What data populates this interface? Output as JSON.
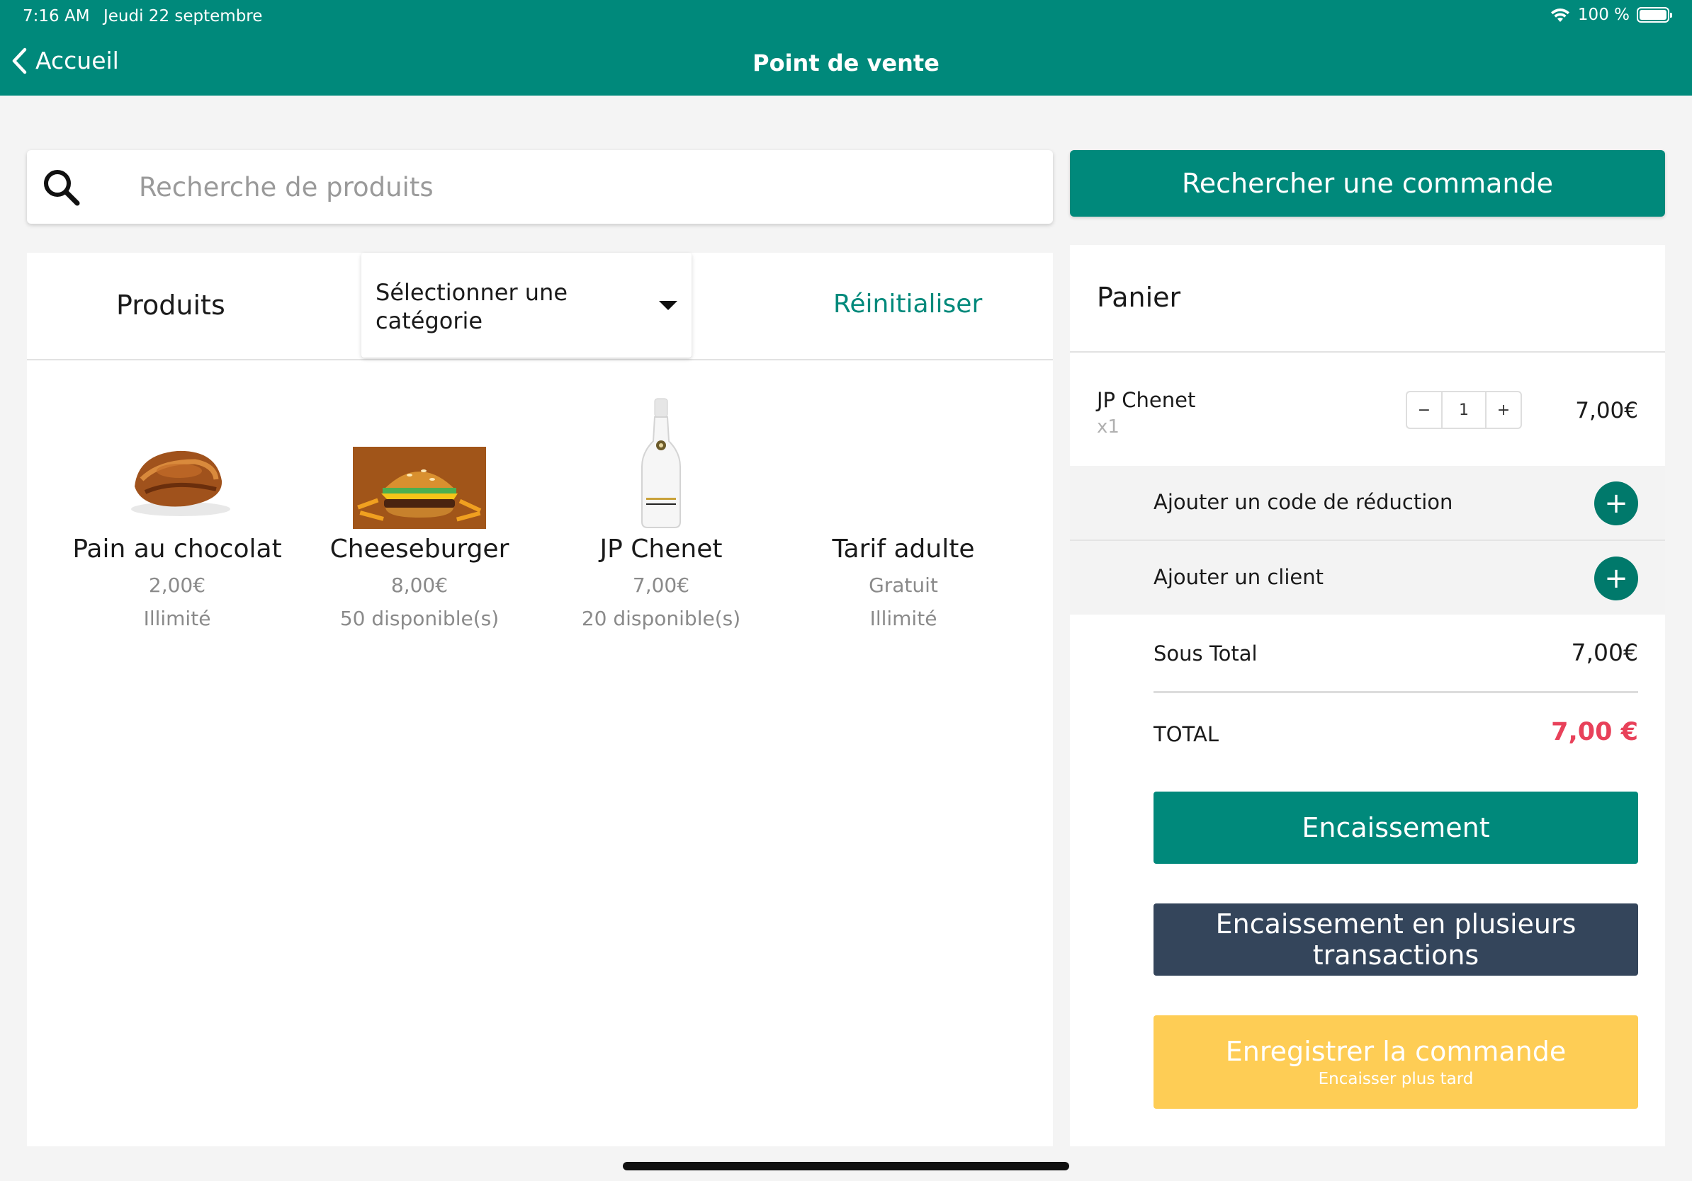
{
  "status_bar": {
    "time": "7:16 AM",
    "date": "Jeudi 22 septembre",
    "battery": "100 %"
  },
  "nav": {
    "back_label": "Accueil",
    "title": "Point de vente"
  },
  "search": {
    "placeholder": "Recherche de produits"
  },
  "find_order_label": "Rechercher une commande",
  "products_panel": {
    "title": "Produits",
    "category_select": "Sélectionner une catégorie",
    "reset_label": "Réinitialiser",
    "items": [
      {
        "name": "Pain au chocolat",
        "price": "2,00€",
        "stock": "Illimité",
        "image": "pain-au-chocolat"
      },
      {
        "name": "Cheeseburger",
        "price": "8,00€",
        "stock": "50 disponible(s)",
        "image": "cheeseburger"
      },
      {
        "name": "JP Chenet",
        "price": "7,00€",
        "stock": "20 disponible(s)",
        "image": "jp-chenet-bottle"
      },
      {
        "name": "Tarif adulte",
        "price": "Gratuit",
        "stock": "Illimité",
        "image": ""
      }
    ]
  },
  "cart": {
    "title": "Panier",
    "items": [
      {
        "name": "JP Chenet",
        "qty_label": "x1",
        "quantity": "1",
        "price": "7,00€"
      }
    ],
    "add_discount_label": "Ajouter un code de réduction",
    "add_client_label": "Ajouter un client",
    "subtotal_label": "Sous Total",
    "subtotal_value": "7,00€",
    "total_label": "TOTAL",
    "total_value": "7,00 €",
    "checkout_label": "Encaissement",
    "multi_checkout_label": "Encaissement en plusieurs transactions",
    "save_order_label": "Enregistrer la commande",
    "save_order_sub": "Encaisser plus tard"
  },
  "colors": {
    "primary": "#00897b",
    "dark": "#34455b",
    "warning": "#fecd55",
    "total": "#e8415a"
  }
}
